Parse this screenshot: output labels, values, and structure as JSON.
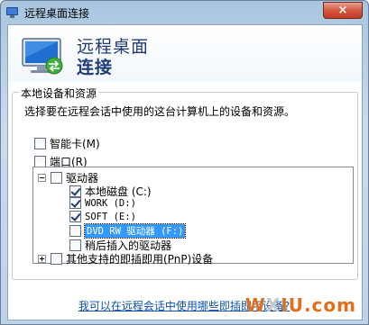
{
  "window": {
    "title": "远程桌面连接",
    "close_glyph": "×"
  },
  "banner": {
    "line1": "远程桌面",
    "line2": "连接"
  },
  "group": {
    "legend": "本地设备和资源",
    "description": "选择要在远程会话中使用的这台计算机上的设备和资源。"
  },
  "options": [
    {
      "label": "智能卡(M)",
      "checked": false
    },
    {
      "label": "端口(R)",
      "checked": false
    }
  ],
  "tree": {
    "drives_label": "驱动器",
    "drives_checked": false,
    "drives": [
      {
        "label": "本地磁盘 (C:)",
        "checked": true
      },
      {
        "label": "WORK (D:)",
        "checked": true
      },
      {
        "label": "SOFT (E:)",
        "checked": true
      },
      {
        "label": "DVD RW 驱动器 (F:)",
        "checked": false,
        "selected": true
      },
      {
        "label": "稍后插入的驱动器",
        "checked": false
      }
    ],
    "other_label": "其他支持的即插即用(PnP)设备",
    "other_checked": false
  },
  "help_link": "我可以在远程会话中使用哪些即插即用设备?",
  "watermark": {
    "a": "W",
    "b": "X",
    "c": "IU.com"
  },
  "colors": {
    "title_text": "#1e3b78",
    "link": "#0b52a8",
    "selection": "#3399ff",
    "watermark_orange": "#e0701e"
  }
}
